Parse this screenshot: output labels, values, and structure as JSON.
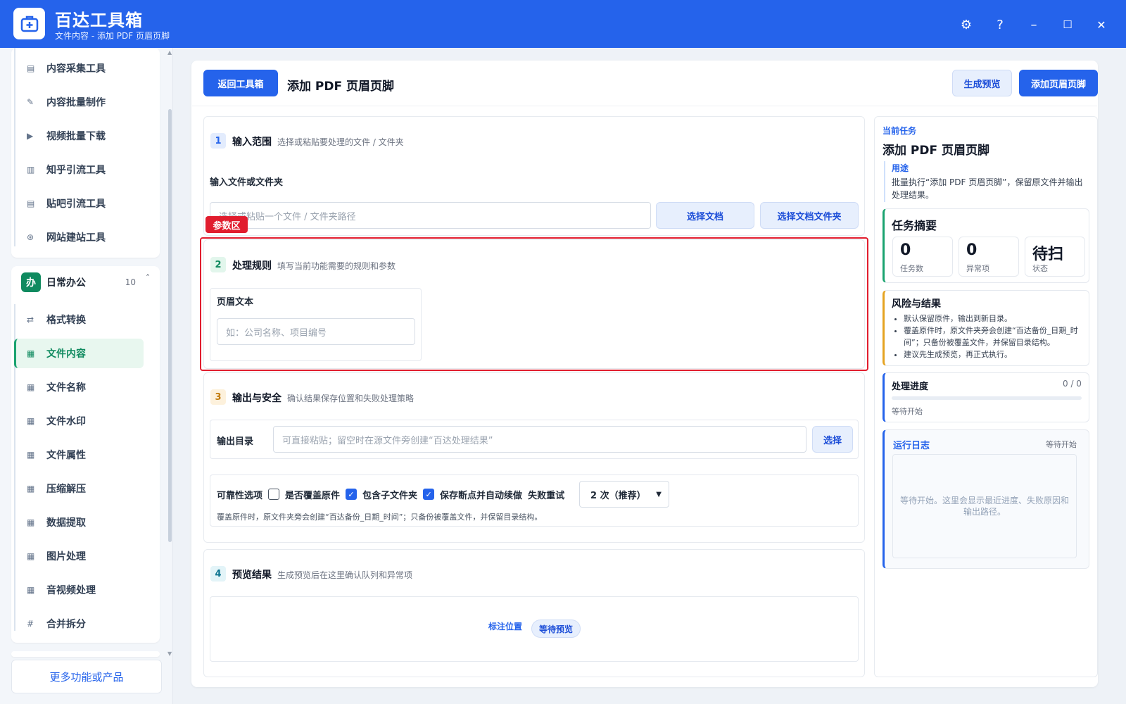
{
  "app": {
    "title": "百达工具箱",
    "subtitle": "文件内容 - 添加 PDF 页眉页脚",
    "controls": {
      "settings": "⚙",
      "help": "?",
      "minimize": "–",
      "maximize": "☐",
      "close": "✕"
    }
  },
  "sidebar": {
    "collect_items": [
      {
        "label": "内容采集工具",
        "icon": "▤"
      },
      {
        "label": "内容批量制作",
        "icon": "✎"
      },
      {
        "label": "视频批量下载",
        "icon": "▶"
      },
      {
        "label": "知乎引流工具",
        "icon": "▥"
      },
      {
        "label": "贴吧引流工具",
        "icon": "▤"
      },
      {
        "label": "网站建站工具",
        "icon": "⊛"
      }
    ],
    "group": {
      "badge": "办",
      "name": "日常办公",
      "count": "10",
      "caret": "˄"
    },
    "office_items": [
      {
        "label": "格式转换",
        "icon": "⇄"
      },
      {
        "label": "文件内容",
        "icon": "▦"
      },
      {
        "label": "文件名称",
        "icon": "▦"
      },
      {
        "label": "文件水印",
        "icon": "▦"
      },
      {
        "label": "文件属性",
        "icon": "▦"
      },
      {
        "label": "压缩解压",
        "icon": "▦"
      },
      {
        "label": "数据提取",
        "icon": "▦"
      },
      {
        "label": "图片处理",
        "icon": "▦"
      },
      {
        "label": "音视频处理",
        "icon": "▦"
      },
      {
        "label": "合并拆分",
        "icon": "#"
      }
    ],
    "more_button": "更多功能或产品"
  },
  "header": {
    "back_button": "返回工具箱",
    "title": "添加 PDF 页眉页脚",
    "preview_button": "生成预览",
    "run_button": "添加页眉页脚"
  },
  "section1": {
    "num": "1",
    "title": "输入范围",
    "desc": "选择或粘贴要处理的文件 / 文件夹",
    "field_label": "输入文件或文件夹",
    "input_placeholder": "选择或粘贴一个文件 / 文件夹路径",
    "select_doc": "选择文档",
    "select_folder": "选择文档文件夹"
  },
  "param_tag": "参数区",
  "section2": {
    "num": "2",
    "title": "处理规则",
    "desc": "填写当前功能需要的规则和参数",
    "field_label": "页眉文本",
    "input_placeholder": "如：公司名称、项目编号"
  },
  "section3": {
    "num": "3",
    "title": "输出与安全",
    "desc": "确认结果保存位置和失败处理策略",
    "output_label": "输出目录",
    "output_placeholder": "可直接粘贴；留空时在源文件旁创建“百达处理结果”",
    "output_select": "选择",
    "options_label": "可靠性选项",
    "opt_overwrite": "是否覆盖原件",
    "opt_overwrite_checked": false,
    "opt_subfolder": "包含子文件夹",
    "opt_subfolder_checked": true,
    "opt_resume": "保存断点并自动续做",
    "opt_resume_checked": true,
    "retry_label": "失败重试",
    "retry_value": "2 次（推荐）",
    "note": "覆盖原件时，原文件夹旁会创建“百达备份_日期_时间”；只备份被覆盖文件，并保留目录结构。"
  },
  "section4": {
    "num": "4",
    "title": "预览结果",
    "desc": "生成预览后在这里确认队列和异常项",
    "marker": "标注位置",
    "status_pill": "等待预览"
  },
  "right_panel": {
    "current_task_label": "当前任务",
    "task_title": "添加 PDF 页眉页脚",
    "purpose_label": "用途",
    "purpose_text": "批量执行“添加 PDF 页眉页脚”，保留原文件并输出处理结果。",
    "summary_title": "任务摘要",
    "stats": [
      {
        "value": "0",
        "label": "任务数"
      },
      {
        "value": "0",
        "label": "异常项"
      },
      {
        "value": "待扫",
        "label": "状态"
      }
    ],
    "risk_title": "风险与结果",
    "risks": [
      "默认保留原件，输出到新目录。",
      "覆盖原件时，原文件夹旁会创建“百达备份_日期_时间”；只备份被覆盖文件，并保留目录结构。",
      "建议先生成预览，再正式执行。"
    ],
    "progress_title": "处理进度",
    "progress_count": "0 / 0",
    "progress_value": 0,
    "progress_status": "等待开始",
    "log_title": "运行日志",
    "log_status": "等待开始",
    "log_placeholder": "等待开始。这里会显示最近进度、失败原因和输出路径。"
  },
  "colors": {
    "brand": "#2563eb",
    "active_green": "#0f8a5f",
    "highlight_red": "#e11d2e"
  }
}
